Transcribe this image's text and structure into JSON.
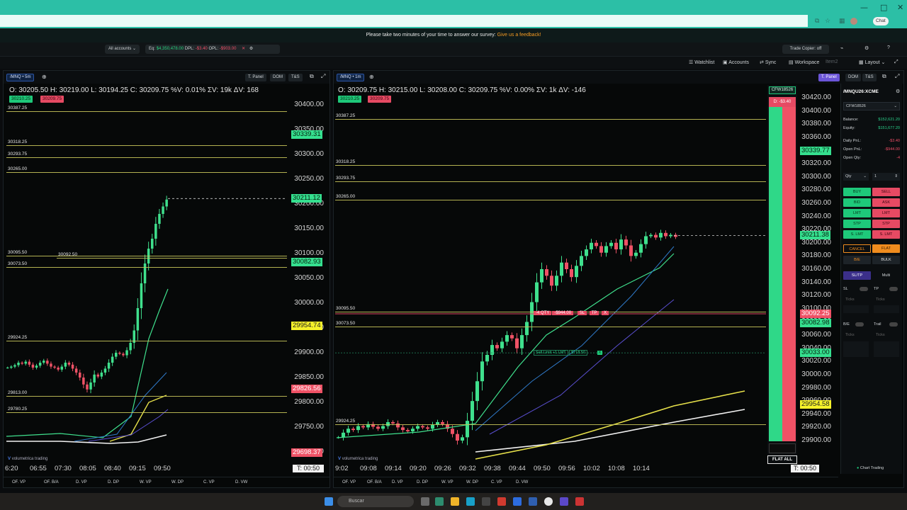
{
  "browser": {
    "chat_label": "Chat"
  },
  "banner": {
    "text": "Please take two minutes of your time to answer our survey:",
    "link": "Give us a feedback!"
  },
  "account_bar": {
    "accounts": "All accounts",
    "eq_label": "Eq:",
    "eq_value": "$4,350,478.00",
    "dpl_label": "DPL:",
    "dpl_value": "-$3.40",
    "opl_label": "OPL:",
    "opl_value": "-$903.00",
    "trade_copier": "Trade Copier: off"
  },
  "toolbar": {
    "watchlist": "Watchlist",
    "accounts": "Accounts",
    "sync": "Sync",
    "workspace": "Workspace",
    "item2": "Item2",
    "layout": "Layout"
  },
  "left_chart": {
    "symbol": "/MNQ",
    "interval": "5m",
    "btn_tpanel": "T. Panel",
    "btn_dom": "DOM",
    "btn_ts": "T&S",
    "ohlc": "O: 30205.50  H: 30219.00  L: 30194.25  C: 30209.75  %V: 0.01%  ΣV: 19k  ΔV: 168",
    "bid_badge": "30210.25",
    "ask_badge": "30209.75",
    "levels": [
      "30387.25",
      "30318.25",
      "30293.75",
      "30265.00",
      "30095.50",
      "30092.50",
      "30073.50",
      "29924.25",
      "29813.00",
      "29780.25"
    ],
    "price_axis": [
      "30400.00",
      "30350.00",
      "30300.00",
      "30250.00",
      "30200.00",
      "30150.00",
      "30100.00",
      "30050.00",
      "30000.00",
      "29950.00",
      "29900.00",
      "29850.00",
      "29800.00",
      "29750.00",
      "29700.00"
    ],
    "tags": {
      "green1": "30339.31",
      "green2": "30211.12",
      "green3": "30082.93",
      "yellow": "29954.74",
      "red1": "29826.56",
      "red2": "29698.37"
    },
    "time_axis": [
      "6:20",
      "06:55",
      "07:30",
      "08:05",
      "08:40",
      "09:15",
      "09:50"
    ],
    "timer": "T: 00:50",
    "footer": [
      "OF. VP",
      "OF. B/A",
      "D. VP",
      "D. DP",
      "W. VP",
      "W. DP",
      "C. VP",
      "D. VW"
    ],
    "logo": "volumetrica trading"
  },
  "right_chart": {
    "symbol": "/MNQ",
    "interval": "1m",
    "btn_tpanel": "T. Panel",
    "btn_dom": "DOM",
    "btn_ts": "T&S",
    "ohlc": "O: 30209.75  H: 30215.00  L: 30208.00  C: 30209.75  %V: 0.00%  ΣV: 1k  ΔV: -146",
    "bid_badge": "30210.25",
    "ask_badge": "30209.75",
    "levels": [
      "30387.25",
      "30318.25",
      "30293.75",
      "30265.00",
      "30095.50",
      "30073.50",
      "29924.25"
    ],
    "price_axis": [
      "30420.00",
      "30400.00",
      "30380.00",
      "30360.00",
      "30340.00",
      "30320.00",
      "30300.00",
      "30280.00",
      "30260.00",
      "30240.00",
      "30220.00",
      "30200.00",
      "30180.00",
      "30160.00",
      "30140.00",
      "30120.00",
      "30100.00",
      "30080.00",
      "30060.00",
      "30040.00",
      "30020.00",
      "30000.00",
      "29980.00",
      "29960.00",
      "29940.00",
      "29920.00",
      "29900.00"
    ],
    "tags": {
      "green1": "30339.77",
      "green2": "30211.38",
      "red": "30092.25",
      "green3": "30082.98",
      "green4": "30033.00",
      "yellow": "29954.58"
    },
    "time_axis": [
      "9:02",
      "09:08",
      "09:14",
      "09:20",
      "09:26",
      "09:32",
      "09:38",
      "09:44",
      "09:50",
      "09:56",
      "10:02",
      "10:08",
      "10:14"
    ],
    "timer": "T: 00:50",
    "position_label": "-4 QTY",
    "position_pnl": "-$944.00",
    "sl": "SL",
    "tp": "TP",
    "x": "X",
    "order_label": "Sell Limit +1 LMT",
    "order_value": "$718.50",
    "account_tag": "CFW18526",
    "daily_badge": "D: -$3.40",
    "flat_all": "FLAT ALL",
    "footer": [
      "OF. VP",
      "OF. B/A",
      "D. VP",
      "D. DP",
      "W. VP",
      "W. DP",
      "C. VP",
      "D. VW"
    ],
    "logo": "volumetrica trading"
  },
  "trading_panel": {
    "instrument": "/MNQU26:XCME",
    "account": "CFW18526",
    "balance_label": "Balance:",
    "balance": "$152,621.20",
    "equity_label": "Equity:",
    "equity": "$151,677.20",
    "daily_pnl_label": "Daily PnL:",
    "daily_pnl": "-$3.40",
    "open_pnl_label": "Open PnL:",
    "open_pnl": "-$944.00",
    "open_qty_label": "Open Qty:",
    "open_qty": "-4",
    "qty_label": "Qty",
    "qty_value": "1",
    "buttons": [
      [
        "BUY",
        "SELL"
      ],
      [
        "BID",
        "ASK"
      ],
      [
        "LMT",
        "LMT"
      ],
      [
        "STP",
        "STP"
      ],
      [
        "S. LMT",
        "S. LMT"
      ]
    ],
    "cancel": "CANCEL",
    "flat": "FLAT",
    "be": "B/E",
    "bulk": "BULK",
    "tab_sltp": "SL/TP",
    "tab_multi": "Multi",
    "sl": "SL",
    "tp": "TP",
    "ticks": "Ticks",
    "be2": "B/E",
    "trail": "Trail",
    "chart_trading": "Chart Trading"
  },
  "taskbar": {
    "search": "Buscar"
  }
}
